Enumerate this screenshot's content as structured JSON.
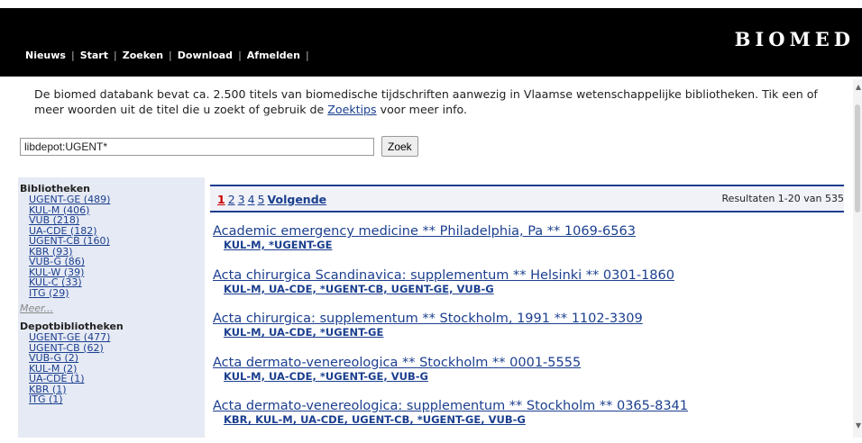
{
  "header": {
    "brand": "BIOMED",
    "nav": [
      {
        "label": "Nieuws"
      },
      {
        "label": "Start"
      },
      {
        "label": "Zoeken"
      },
      {
        "label": "Download"
      },
      {
        "label": "Afmelden"
      }
    ]
  },
  "intro": {
    "text_before": "De biomed databank bevat ca. 2.500 titels van biomedische tijdschriften aanwezig in Vlaamse wetenschappelijke bibliotheken. Tik een of meer woorden uit de titel die u zoekt of gebruik de ",
    "link": "Zoektips",
    "text_after": " voor meer info."
  },
  "search": {
    "value": "libdepot:UGENT*",
    "button": "Zoek"
  },
  "sidebar": {
    "libraries_heading": "Bibliotheken",
    "libraries": [
      "UGENT-GE (489)",
      "KUL-M (406)",
      "VUB (218)",
      "UA-CDE (182)",
      "UGENT-CB (160)",
      "KBR (93)",
      "VUB-G (86)",
      "KUL-W (39)",
      "KUL-C (33)",
      "ITG (29)"
    ],
    "more": "Meer...",
    "depot_heading": "Depotbibliotheken",
    "depot": [
      "UGENT-GE (477)",
      "UGENT-CB (62)",
      "VUB-G (2)",
      "KUL-M (2)",
      "UA-CDE (1)",
      "KBR (1)",
      "ITG (1)"
    ]
  },
  "pagination": {
    "pages": [
      "1",
      "2",
      "3",
      "4",
      "5"
    ],
    "next": "Volgende",
    "summary": "Resultaten 1-20 van 535"
  },
  "results": [
    {
      "title": "Academic emergency medicine ** Philadelphia, Pa ** 1069-6563",
      "libs": "KUL-M, *UGENT-GE"
    },
    {
      "title": "Acta chirurgica Scandinavica: supplementum ** Helsinki ** 0301-1860",
      "libs": "KUL-M, UA-CDE, *UGENT-CB, UGENT-GE, VUB-G"
    },
    {
      "title": "Acta chirurgica: supplementum ** Stockholm, 1991 ** 1102-3309",
      "libs": "KUL-M, UA-CDE, *UGENT-GE"
    },
    {
      "title": "Acta dermato-venereologica ** Stockholm ** 0001-5555",
      "libs": "KUL-M, UA-CDE, *UGENT-GE, VUB-G"
    },
    {
      "title": "Acta dermato-venereologica: supplementum ** Stockholm ** 0365-8341",
      "libs": "KBR, KUL-M, UA-CDE, UGENT-CB, *UGENT-GE, VUB-G"
    }
  ]
}
